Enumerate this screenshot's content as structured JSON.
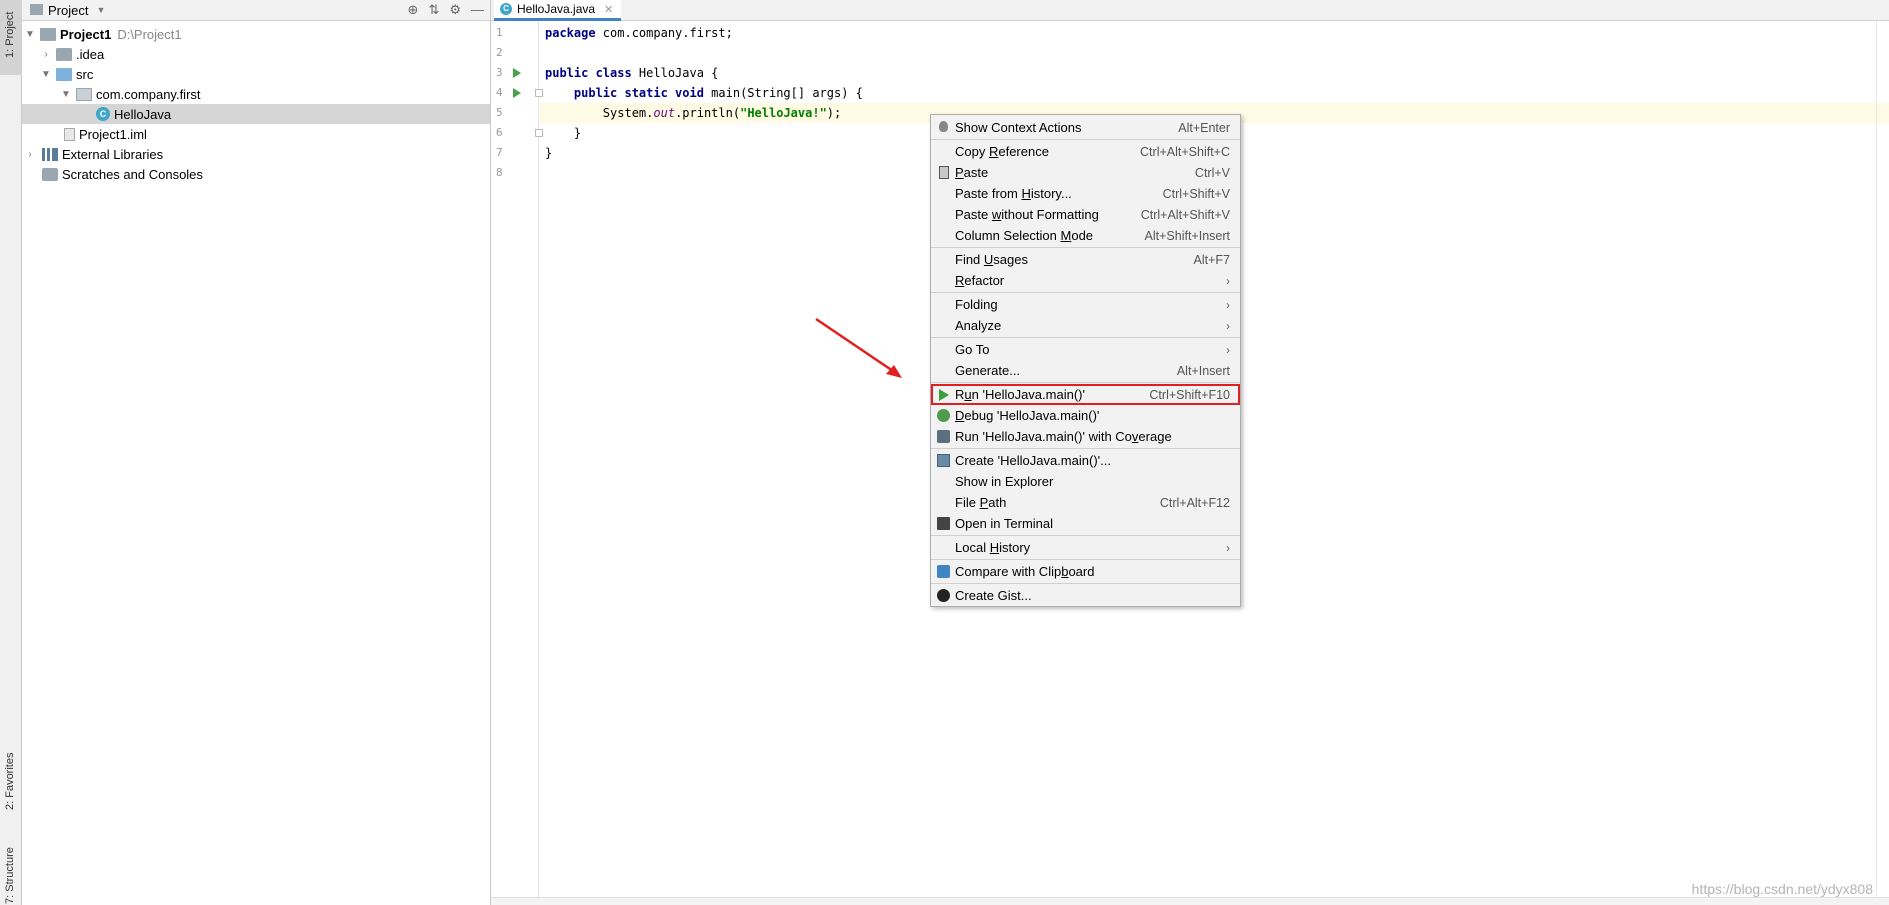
{
  "tool_stripe": {
    "project_tab": "1: Project",
    "favorites_tab": "2: Favorites",
    "structure_tab": "7: Structure"
  },
  "project_panel": {
    "title": "Project",
    "tree": [
      {
        "label": "Project1",
        "hint": "D:\\Project1",
        "icon": "project-folder-icon"
      },
      {
        "label": ".idea",
        "icon": "folder-icon"
      },
      {
        "label": "src",
        "icon": "source-folder-icon"
      },
      {
        "label": "com.company.first",
        "icon": "package-icon"
      },
      {
        "label": "HelloJava",
        "icon": "java-class-icon"
      },
      {
        "label": "Project1.iml",
        "icon": "iml-file-icon"
      },
      {
        "label": "External Libraries",
        "icon": "libraries-icon"
      },
      {
        "label": "Scratches and Consoles",
        "icon": "scratches-icon"
      }
    ]
  },
  "editor": {
    "tab_label": "HelloJava.java",
    "line_numbers": [
      "1",
      "2",
      "3",
      "4",
      "5",
      "6",
      "7",
      "8"
    ],
    "code": {
      "l1_kw": "package",
      "l1_rest": " com.company.first;",
      "l3_kw": "public class",
      "l3_rest": " HelloJava {",
      "l4_kw": "    public static void",
      "l4_rest": " main(String[] args) {",
      "l5_a": "        System.",
      "l5_field": "out",
      "l5_b": ".println(",
      "l5_str": "\"HelloJava!\"",
      "l5_c": ");",
      "l6": "    }",
      "l7": "}"
    }
  },
  "context_menu": {
    "items": [
      {
        "label": "Show Context Actions",
        "shortcut": "Alt+Enter",
        "icon": "bulb-icon"
      },
      {
        "label_pre": "Copy ",
        "label_u": "R",
        "label_post": "eference",
        "shortcut": "Ctrl+Alt+Shift+C"
      },
      {
        "label_pre": "",
        "label_u": "P",
        "label_post": "aste",
        "shortcut": "Ctrl+V",
        "icon": "paste-icon"
      },
      {
        "label_pre": "Paste from ",
        "label_u": "H",
        "label_post": "istory...",
        "shortcut": "Ctrl+Shift+V"
      },
      {
        "label_pre": "Paste ",
        "label_u": "w",
        "label_post": "ithout Formatting",
        "shortcut": "Ctrl+Alt+Shift+V"
      },
      {
        "label_pre": "Column Selection ",
        "label_u": "M",
        "label_post": "ode",
        "shortcut": "Alt+Shift+Insert"
      },
      {
        "label_pre": "Find ",
        "label_u": "U",
        "label_post": "sages",
        "shortcut": "Alt+F7"
      },
      {
        "label_pre": "",
        "label_u": "R",
        "label_post": "efactor",
        "submenu": "›"
      },
      {
        "label": "Folding",
        "submenu": "›"
      },
      {
        "label": "Analyze",
        "submenu": "›"
      },
      {
        "label": "Go To",
        "submenu": "›"
      },
      {
        "label": "Generate...",
        "shortcut": "Alt+Insert"
      },
      {
        "label_pre": "R",
        "label_u": "u",
        "label_post": "n 'HelloJava.main()'",
        "shortcut": "Ctrl+Shift+F10",
        "icon": "run-icon"
      },
      {
        "label_pre": "",
        "label_u": "D",
        "label_post": "ebug 'HelloJava.main()'",
        "icon": "debug-icon"
      },
      {
        "label_pre": "Run 'HelloJava.main()' with Co",
        "label_u": "v",
        "label_post": "erage",
        "icon": "coverage-icon"
      },
      {
        "label": "Create 'HelloJava.main()'...",
        "icon": "create-config-icon"
      },
      {
        "label": "Show in Explorer"
      },
      {
        "label_pre": "File ",
        "label_u": "P",
        "label_post": "ath",
        "shortcut": "Ctrl+Alt+F12"
      },
      {
        "label": "Open in Terminal",
        "icon": "terminal-icon"
      },
      {
        "label_pre": "Local ",
        "label_u": "H",
        "label_post": "istory",
        "submenu": "›"
      },
      {
        "label_pre": "Compare with Clip",
        "label_u": "b",
        "label_post": "oard",
        "icon": "compare-icon"
      },
      {
        "label": "Create Gist...",
        "icon": "github-icon"
      }
    ]
  },
  "watermark": "https://blog.csdn.net/ydyx808",
  "colors": {
    "highlight_border": "#e02020",
    "arrow": "#e02020",
    "run_green": "#4aa14b",
    "keyword": "#000080",
    "string": "#008000"
  }
}
